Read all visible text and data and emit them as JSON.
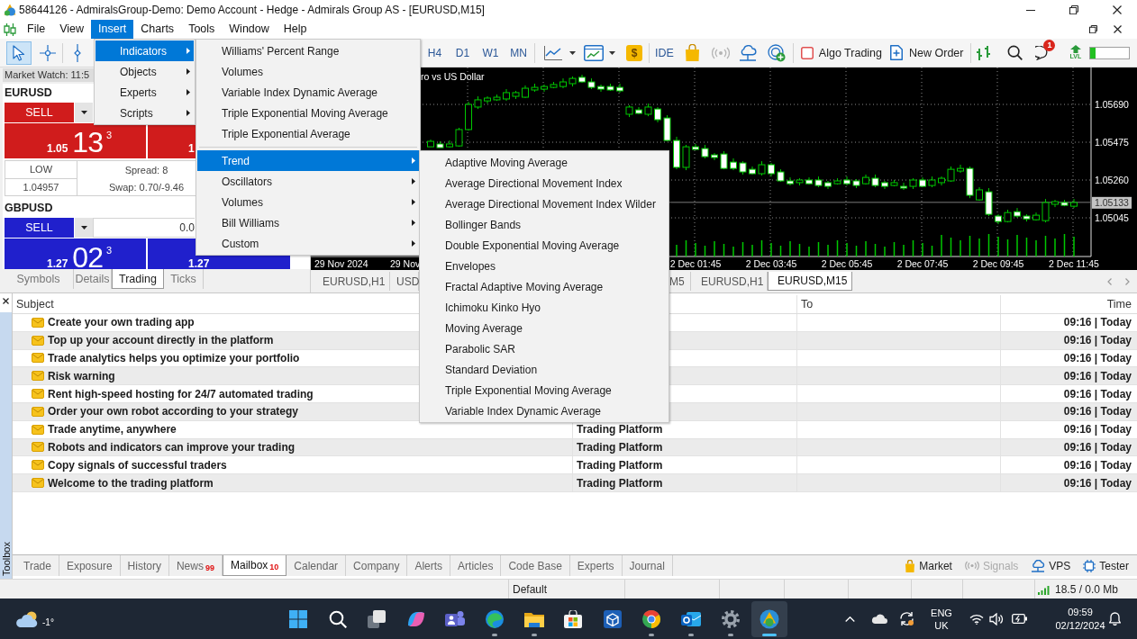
{
  "window": {
    "title": "58644126 - AdmiralsGroup-Demo: Demo Account - Hedge - Admirals Group AS - [EURUSD,M15]"
  },
  "menu_bar": [
    {
      "label": "File",
      "selected": false
    },
    {
      "label": "View",
      "selected": false
    },
    {
      "label": "Insert",
      "selected": true
    },
    {
      "label": "Charts",
      "selected": false
    },
    {
      "label": "Tools",
      "selected": false
    },
    {
      "label": "Window",
      "selected": false
    },
    {
      "label": "Help",
      "selected": false
    }
  ],
  "insert_menu": {
    "items": [
      {
        "label": "Indicators",
        "selected": true,
        "submenu": true
      },
      {
        "label": "Objects",
        "selected": false,
        "submenu": true
      },
      {
        "label": "Experts",
        "selected": false,
        "submenu": true
      },
      {
        "label": "Scripts",
        "selected": false,
        "submenu": true
      }
    ]
  },
  "indicators_menu": {
    "groups": [
      [
        {
          "label": "Williams' Percent Range",
          "selected": false,
          "submenu": false
        },
        {
          "label": "Volumes",
          "selected": false,
          "submenu": false
        },
        {
          "label": "Variable Index Dynamic Average",
          "selected": false,
          "submenu": false
        },
        {
          "label": "Triple Exponential Moving Average",
          "selected": false,
          "submenu": false
        },
        {
          "label": "Triple Exponential Average",
          "selected": false,
          "submenu": false
        }
      ],
      [
        {
          "label": "Trend",
          "selected": true,
          "submenu": true
        },
        {
          "label": "Oscillators",
          "selected": false,
          "submenu": true
        },
        {
          "label": "Volumes",
          "selected": false,
          "submenu": true
        },
        {
          "label": "Bill Williams",
          "selected": false,
          "submenu": true
        },
        {
          "label": "Custom",
          "selected": false,
          "submenu": true
        }
      ]
    ]
  },
  "trend_menu": {
    "items": [
      {
        "label": "Adaptive Moving Average",
        "selected": false
      },
      {
        "label": "Average Directional Movement Index",
        "selected": false
      },
      {
        "label": "Average Directional Movement Index Wilder",
        "selected": false
      },
      {
        "label": "Bollinger Bands",
        "selected": false
      },
      {
        "label": "Double Exponential Moving Average",
        "selected": false
      },
      {
        "label": "Envelopes",
        "selected": false
      },
      {
        "label": "Fractal Adaptive Moving Average",
        "selected": false
      },
      {
        "label": "Ichimoku Kinko Hyo",
        "selected": false
      },
      {
        "label": "Moving Average",
        "selected": false
      },
      {
        "label": "Parabolic SAR",
        "selected": false
      },
      {
        "label": "Standard Deviation",
        "selected": false
      },
      {
        "label": "Triple Exponential Moving Average",
        "selected": false
      },
      {
        "label": "Variable Index Dynamic Average",
        "selected": false
      }
    ]
  },
  "toolbar": {
    "tools": [
      {
        "selected": true
      },
      {
        "selected": false
      },
      {
        "selected": false
      }
    ],
    "periods": [
      {
        "label": "H4",
        "selected": false
      },
      {
        "label": "D1",
        "selected": false
      },
      {
        "label": "W1",
        "selected": false
      },
      {
        "label": "MN",
        "selected": false
      }
    ],
    "market_symbol": "$",
    "ide": "IDE",
    "signals": {
      "disabled": true
    },
    "algo_trading": {
      "label": "Algo Trading",
      "on": false
    },
    "new_order": "New Order",
    "notification_badge": "1",
    "level_label": "LVL",
    "level_meter": {
      "level": 0.14
    }
  },
  "market_watch": {
    "title": "Market Watch: 11:5",
    "symbols": [
      {
        "name": "EURUSD",
        "color": "#d01c1c",
        "sell": "SELL",
        "bid": {
          "prefix": "1.05",
          "big": "13",
          "sup": "3"
        },
        "ask": {
          "prefix": "1"
        },
        "low_label": "LOW",
        "low": "1.04957",
        "spread": "Spread: 8",
        "swap": "Swap: 0.70/-9.46"
      },
      {
        "name": "GBPUSD",
        "color": "#2020cc",
        "sell": "SELL",
        "lot": "0.0",
        "bid": {
          "prefix": "1.27",
          "big": "02",
          "sup": "3"
        },
        "ask": {
          "prefix": "1.27"
        }
      }
    ],
    "tabs": [
      {
        "label": "Symbols",
        "selected": false
      },
      {
        "label": "Details",
        "selected": false
      },
      {
        "label": "Trading",
        "selected": true
      },
      {
        "label": "Ticks",
        "selected": false
      }
    ]
  },
  "chart": {
    "chart_data": {
      "type": "candlestick",
      "title": "ro vs US Dollar",
      "grid": true,
      "categories": [
        null,
        null,
        null,
        null,
        null,
        null,
        null,
        null,
        null,
        null,
        null,
        null,
        null,
        null,
        null,
        null,
        null,
        null,
        null,
        null,
        null,
        null,
        null,
        null,
        null,
        null,
        null,
        null,
        "2 Dec 01:45",
        null,
        null,
        null,
        null,
        null,
        null,
        null,
        "2 Dec 03:45",
        null,
        null,
        null,
        null,
        null,
        null,
        null,
        "2 Dec 05:45",
        null,
        null,
        null,
        null,
        null,
        null,
        null,
        "2 Dec 07:45",
        null,
        null,
        null,
        null,
        null,
        null,
        null,
        "2 Dec 09:45",
        null,
        null,
        null,
        null,
        null,
        null,
        null,
        "2 Dec 11:45"
      ],
      "ohlc": [
        [
          1.05449,
          1.0549,
          1.05449,
          1.0548
        ],
        [
          1.05465,
          1.0548,
          1.05444,
          1.05444
        ],
        [
          1.05449,
          1.05485,
          1.05444,
          1.05465
        ],
        [
          1.05454,
          1.05557,
          1.05449,
          1.05547
        ],
        [
          1.05547,
          1.05705,
          1.05541,
          1.0569
        ],
        [
          1.05675,
          1.05736,
          1.05664,
          1.05716
        ],
        [
          1.0571,
          1.05736,
          1.05695,
          1.05726
        ],
        [
          1.05716,
          1.05746,
          1.0571,
          1.05731
        ],
        [
          1.05721,
          1.05777,
          1.0571,
          1.05757
        ],
        [
          1.05736,
          1.05767,
          1.05721,
          1.05757
        ],
        [
          1.05731,
          1.05798,
          1.05726,
          1.05782
        ],
        [
          1.05772,
          1.05808,
          1.05762,
          1.05787
        ],
        [
          1.05777,
          1.05803,
          1.05762,
          1.05792
        ],
        [
          1.05787,
          1.05818,
          1.05782,
          1.05803
        ],
        [
          1.05792,
          1.05838,
          1.05782,
          1.05818
        ],
        [
          1.05808,
          1.05849,
          1.05792,
          1.05838
        ],
        [
          1.05844,
          1.05859,
          1.05813,
          1.05818
        ],
        [
          1.05818,
          1.05838,
          1.05777,
          1.05787
        ],
        [
          1.05792,
          1.05803,
          1.05762,
          1.05777
        ],
        [
          1.05792,
          1.05808,
          1.05767,
          1.05772
        ],
        [
          1.05787,
          1.05808,
          1.05757,
          1.05767
        ],
        [
          1.05634,
          1.05685,
          1.05618,
          1.05675
        ],
        [
          1.05659,
          1.05675,
          1.05634,
          1.05639
        ],
        [
          1.05634,
          1.05695,
          1.05623,
          1.05675
        ],
        [
          1.05664,
          1.05675,
          1.05588,
          1.05603
        ],
        [
          1.05613,
          1.05629,
          1.0548,
          1.05485
        ],
        [
          1.05485,
          1.05506,
          1.05321,
          1.05332
        ],
        [
          1.05332,
          1.0546,
          1.05316,
          1.05449
        ],
        [
          1.05449,
          1.05465,
          1.05429,
          1.05434
        ],
        [
          1.05439,
          1.0546,
          1.05383,
          1.05393
        ],
        [
          1.05403,
          1.05413,
          1.05373,
          1.05388
        ],
        [
          1.05408,
          1.05424,
          1.05321,
          1.05326
        ],
        [
          1.05362,
          1.05383,
          1.05316,
          1.05326
        ],
        [
          1.05357,
          1.05367,
          1.05291,
          1.05306
        ],
        [
          1.05321,
          1.05337,
          1.05291,
          1.05296
        ],
        [
          1.05296,
          1.05367,
          1.05286,
          1.05347
        ],
        [
          1.05347,
          1.05357,
          1.0528,
          1.05296
        ],
        [
          1.05306,
          1.05321,
          1.0525,
          1.05255
        ],
        [
          1.05255,
          1.05275,
          1.05229,
          1.05239
        ],
        [
          1.05245,
          1.0527,
          1.05229,
          1.0526
        ],
        [
          1.0526,
          1.05275,
          1.05234,
          1.05239
        ],
        [
          1.0526,
          1.0528,
          1.05219,
          1.05229
        ],
        [
          1.05245,
          1.05255,
          1.05209,
          1.05224
        ],
        [
          1.05239,
          1.0527,
          1.05234,
          1.05255
        ],
        [
          1.0526,
          1.0528,
          1.05229,
          1.05239
        ],
        [
          1.05255,
          1.05265,
          1.05214,
          1.05229
        ],
        [
          1.05239,
          1.05291,
          1.05234,
          1.05275
        ],
        [
          1.0527,
          1.05291,
          1.05219,
          1.05229
        ],
        [
          1.05245,
          1.05255,
          1.05209,
          1.05224
        ],
        [
          1.05229,
          1.0526,
          1.05224,
          1.05245
        ],
        [
          1.05224,
          1.05245,
          1.05204,
          1.05214
        ],
        [
          1.05224,
          1.0527,
          1.05209,
          1.0526
        ],
        [
          1.0526,
          1.05275,
          1.05219,
          1.05224
        ],
        [
          1.05229,
          1.0528,
          1.05219,
          1.0526
        ],
        [
          1.05245,
          1.0528,
          1.05229,
          1.0527
        ],
        [
          1.05255,
          1.05337,
          1.0525,
          1.05321
        ],
        [
          1.05311,
          1.05347,
          1.05301,
          1.05326
        ],
        [
          1.05326,
          1.05337,
          1.05157,
          1.05173
        ],
        [
          1.05147,
          1.05219,
          1.05142,
          1.05204
        ],
        [
          1.05193,
          1.05214,
          1.05055,
          1.05065
        ],
        [
          1.05055,
          1.05065,
          1.05009,
          1.05024
        ],
        [
          1.05024,
          1.05091,
          1.05019,
          1.05075
        ],
        [
          1.0508,
          1.05101,
          1.05045,
          1.05055
        ],
        [
          1.05055,
          1.05065,
          1.05024,
          1.05039
        ],
        [
          1.05034,
          1.05075,
          1.05029,
          1.0506
        ],
        [
          1.05029,
          1.05152,
          1.05019,
          1.05132
        ],
        [
          1.05122,
          1.05147,
          1.05106,
          1.05137
        ],
        [
          1.05132,
          1.05147,
          1.05111,
          1.05116
        ],
        [
          1.05111,
          1.05152,
          1.05101,
          1.05132
        ]
      ],
      "ylim": [
        1.04825,
        1.059
      ],
      "yticks": [
        {
          "value": 1.0569,
          "label": "1.05690"
        },
        {
          "value": 1.05475,
          "label": "1.05475"
        },
        {
          "value": 1.0526,
          "label": "1.05260"
        },
        {
          "value": 1.05045,
          "label": "1.05045"
        }
      ],
      "ref_lines": [
        {
          "axis": "y",
          "value": 1.05133,
          "label": "1.05133"
        }
      ]
    },
    "earlier_time_labels": [
      "29 Nov 2024",
      "29 Nov"
    ],
    "tabs": [
      {
        "label": "EURUSD,H1",
        "selected": false
      },
      {
        "label": "USD",
        "selected": false
      },
      {
        "label": "M5",
        "selected": false
      },
      {
        "label": "EURUSD,H1",
        "selected": false
      },
      {
        "label": "EURUSD,M15",
        "selected": true
      }
    ]
  },
  "toolbox": {
    "title": "Toolbox",
    "columns": [
      "Subject",
      "To",
      "Time"
    ],
    "messages": [
      {
        "subject": "Create your own trading app",
        "time": "09:16 | Today",
        "unread": true
      },
      {
        "subject": "Top up your account directly in the platform",
        "time": "09:16 | Today",
        "unread": true
      },
      {
        "subject": "Trade analytics helps you optimize your portfolio",
        "time": "09:16 | Today",
        "unread": true
      },
      {
        "subject": "Risk warning",
        "time": "09:16 | Today",
        "unread": true
      },
      {
        "subject": "Rent high-speed hosting for 24/7 automated trading",
        "time": "09:16 | Today",
        "unread": true
      },
      {
        "subject": "Order your own robot according to your strategy",
        "time": "09:16 | Today",
        "unread": true
      },
      {
        "subject": "Trade anytime, anywhere",
        "from": "Trading Platform",
        "time": "09:16 | Today",
        "unread": true
      },
      {
        "subject": "Robots and indicators can improve your trading",
        "from": "Trading Platform",
        "time": "09:16 | Today",
        "unread": true
      },
      {
        "subject": "Copy signals of successful traders",
        "from": "Trading Platform",
        "time": "09:16 | Today",
        "unread": true
      },
      {
        "subject": "Welcome to the trading platform",
        "from": "Trading Platform",
        "time": "09:16 | Today",
        "unread": true
      }
    ],
    "tabs": [
      {
        "label": "Trade",
        "selected": false
      },
      {
        "label": "Exposure",
        "selected": false
      },
      {
        "label": "History",
        "selected": false
      },
      {
        "label": "News",
        "badge": "99",
        "selected": false
      },
      {
        "label": "Mailbox",
        "badge": "10",
        "selected": true
      },
      {
        "label": "Calendar",
        "selected": false
      },
      {
        "label": "Company",
        "selected": false
      },
      {
        "label": "Alerts",
        "selected": false
      },
      {
        "label": "Articles",
        "selected": false
      },
      {
        "label": "Code Base",
        "selected": false
      },
      {
        "label": "Experts",
        "selected": false
      },
      {
        "label": "Journal",
        "selected": false
      }
    ],
    "links": [
      {
        "label": "Market",
        "disabled": false
      },
      {
        "label": "Signals",
        "disabled": true
      },
      {
        "label": "VPS",
        "disabled": false
      },
      {
        "label": "Tester",
        "disabled": false
      }
    ]
  },
  "status_bar": {
    "profile": "Default",
    "traffic": "18.5 / 0.0 Mb"
  },
  "taskbar": {
    "temperature": "-1°",
    "apps": [
      {
        "running": false,
        "active": false
      },
      {
        "running": false,
        "active": false
      },
      {
        "running": false,
        "active": false
      },
      {
        "running": false,
        "active": false
      },
      {
        "running": false,
        "active": false
      },
      {
        "running": true,
        "active": false
      },
      {
        "running": true,
        "active": false
      },
      {
        "running": false,
        "active": false
      },
      {
        "running": false,
        "active": false
      },
      {
        "running": true,
        "active": false
      },
      {
        "running": true,
        "active": false
      },
      {
        "running": true,
        "active": false
      },
      {
        "running": true,
        "active": true
      }
    ],
    "language": "ENG",
    "region": "UK",
    "time": "09:59",
    "date": "02/12/2024"
  }
}
